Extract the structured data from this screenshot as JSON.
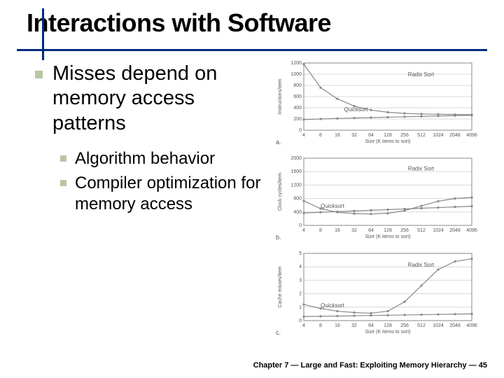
{
  "title": "Interactions with Software",
  "bullets": {
    "main": "Misses depend on memory access patterns",
    "subs": [
      "Algorithm behavior",
      "Compiler optimization for memory access"
    ]
  },
  "footer": "Chapter 7 — Large and Fast: Exploiting Memory Hierarchy — 45",
  "chart_data": [
    {
      "type": "line",
      "panel": "a.",
      "ylabel": "Instructions/item",
      "xlabel": "Size (K items to sort)",
      "categories": [
        "4",
        "8",
        "16",
        "32",
        "64",
        "128",
        "256",
        "512",
        "1024",
        "2048",
        "4096"
      ],
      "ylim": [
        0,
        1200
      ],
      "yticks": [
        0,
        200,
        400,
        600,
        800,
        1000,
        1200
      ],
      "series": [
        {
          "name": "Radix Sort",
          "values": [
            1180,
            760,
            560,
            430,
            360,
            320,
            300,
            290,
            285,
            280,
            278
          ]
        },
        {
          "name": "Quicksort",
          "values": [
            190,
            200,
            210,
            218,
            225,
            232,
            240,
            247,
            254,
            260,
            266
          ]
        }
      ],
      "labels": [
        "Radix Sort",
        "Quicksort"
      ],
      "label_pos": [
        [
          0.62,
          0.2
        ],
        [
          0.24,
          0.72
        ]
      ]
    },
    {
      "type": "line",
      "panel": "b.",
      "ylabel": "Clock cycles/item",
      "xlabel": "Size (K items to sort)",
      "categories": [
        "4",
        "8",
        "16",
        "32",
        "64",
        "128",
        "256",
        "512",
        "1024",
        "2048",
        "4096"
      ],
      "ylim": [
        0,
        2000
      ],
      "yticks": [
        0,
        400,
        800,
        1200,
        1600,
        2000
      ],
      "series": [
        {
          "name": "Radix Sort",
          "values": [
            730,
            500,
            390,
            350,
            340,
            360,
            440,
            580,
            720,
            800,
            830
          ]
        },
        {
          "name": "Quicksort",
          "values": [
            370,
            390,
            410,
            430,
            450,
            470,
            490,
            510,
            530,
            550,
            570
          ]
        }
      ],
      "labels": [
        "Radix Sort",
        "Quicksort"
      ],
      "label_pos": [
        [
          0.62,
          0.18
        ],
        [
          0.1,
          0.74
        ]
      ]
    },
    {
      "type": "line",
      "panel": "c.",
      "ylabel": "Cache misses/item",
      "xlabel": "Size (K items to sort)",
      "categories": [
        "4",
        "8",
        "16",
        "32",
        "64",
        "128",
        "256",
        "512",
        "1024",
        "2048",
        "4096"
      ],
      "ylim": [
        0,
        5
      ],
      "yticks": [
        0,
        1,
        2,
        3,
        4,
        5
      ],
      "series": [
        {
          "name": "Radix Sort",
          "values": [
            1.2,
            0.9,
            0.7,
            0.6,
            0.55,
            0.7,
            1.4,
            2.6,
            3.8,
            4.4,
            4.6
          ]
        },
        {
          "name": "Quicksort",
          "values": [
            0.3,
            0.32,
            0.34,
            0.36,
            0.38,
            0.4,
            0.42,
            0.44,
            0.46,
            0.48,
            0.5
          ]
        }
      ],
      "labels": [
        "Radix Sort",
        "Quicksort"
      ],
      "label_pos": [
        [
          0.62,
          0.2
        ],
        [
          0.1,
          0.8
        ]
      ]
    }
  ]
}
